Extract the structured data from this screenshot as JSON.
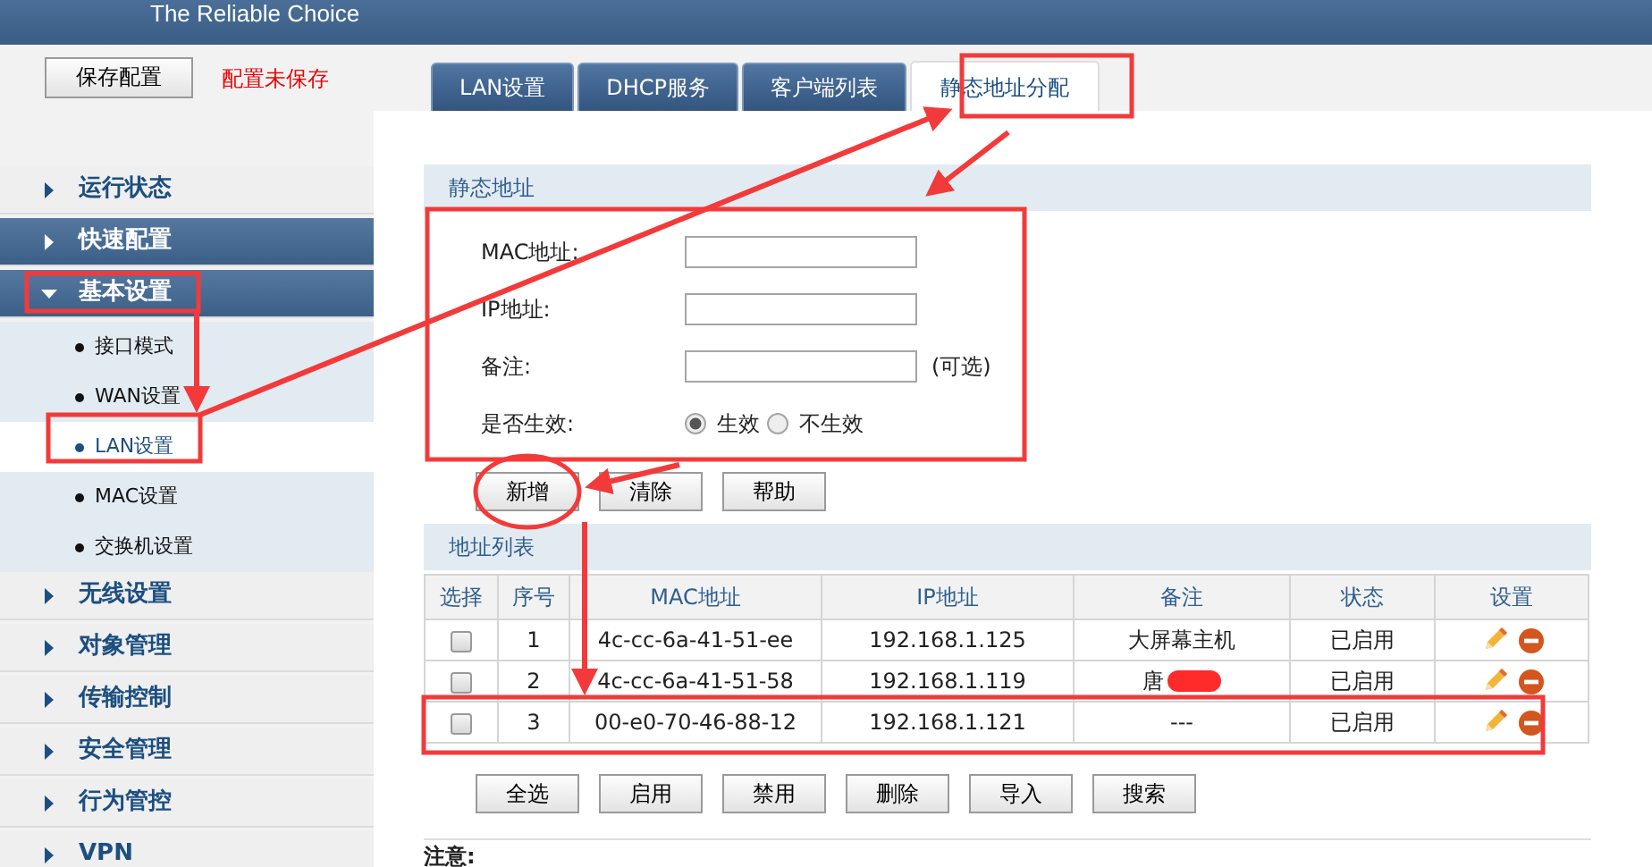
{
  "header": {
    "tagline": "The Reliable Choice"
  },
  "toolbar": {
    "save_button": "保存配置",
    "notice": "配置未保存"
  },
  "tabs": [
    {
      "label": "LAN设置",
      "selected": false
    },
    {
      "label": "DHCP服务",
      "selected": false
    },
    {
      "label": "客户端列表",
      "selected": false
    },
    {
      "label": "静态地址分配",
      "selected": true
    }
  ],
  "sidebar": {
    "items": [
      {
        "label": "运行状态",
        "expanded": false,
        "highlighted": false
      },
      {
        "label": "快速配置",
        "expanded": false,
        "highlighted": true
      },
      {
        "label": "基本设置",
        "expanded": true,
        "highlighted": true,
        "children": [
          {
            "label": "接口模式",
            "selected": false
          },
          {
            "label": "WAN设置",
            "selected": false
          },
          {
            "label": "LAN设置",
            "selected": true
          },
          {
            "label": "MAC设置",
            "selected": false
          },
          {
            "label": "交换机设置",
            "selected": false
          }
        ]
      },
      {
        "label": "无线设置",
        "expanded": false,
        "highlighted": false
      },
      {
        "label": "对象管理",
        "expanded": false,
        "highlighted": false
      },
      {
        "label": "传输控制",
        "expanded": false,
        "highlighted": false
      },
      {
        "label": "安全管理",
        "expanded": false,
        "highlighted": false
      },
      {
        "label": "行为管控",
        "expanded": false,
        "highlighted": false
      },
      {
        "label": "VPN",
        "expanded": false,
        "highlighted": false
      }
    ]
  },
  "form": {
    "title": "静态地址",
    "fields": [
      {
        "kind": "text",
        "label": "MAC地址:"
      },
      {
        "kind": "text",
        "label": "IP地址:"
      },
      {
        "kind": "text",
        "label": "备注:",
        "suffix": "(可选)"
      },
      {
        "kind": "radio",
        "label": "是否生效:",
        "options": [
          {
            "label": "生效",
            "selected": true
          },
          {
            "label": "不生效",
            "selected": false
          }
        ]
      }
    ],
    "buttons": [
      "新增",
      "清除",
      "帮助"
    ]
  },
  "table": {
    "title": "地址列表",
    "columns": [
      "选择",
      "序号",
      "MAC地址",
      "IP地址",
      "备注",
      "状态",
      "设置"
    ],
    "rows": [
      {
        "checked": false,
        "index": "1",
        "mac": "4c-cc-6a-41-51-ee",
        "ip": "192.168.1.125",
        "note": "大屏幕主机",
        "redacted": false,
        "status": "已启用"
      },
      {
        "checked": false,
        "index": "2",
        "mac": "4c-cc-6a-41-51-58",
        "ip": "192.168.1.119",
        "note": "唐",
        "redacted": true,
        "status": "已启用"
      },
      {
        "checked": false,
        "index": "3",
        "mac": "00-e0-70-46-88-12",
        "ip": "192.168.1.121",
        "note": "---",
        "redacted": false,
        "status": "已启用"
      }
    ],
    "buttons": [
      "全选",
      "启用",
      "禁用",
      "删除",
      "导入",
      "搜索"
    ]
  },
  "note_heading": "注意:"
}
